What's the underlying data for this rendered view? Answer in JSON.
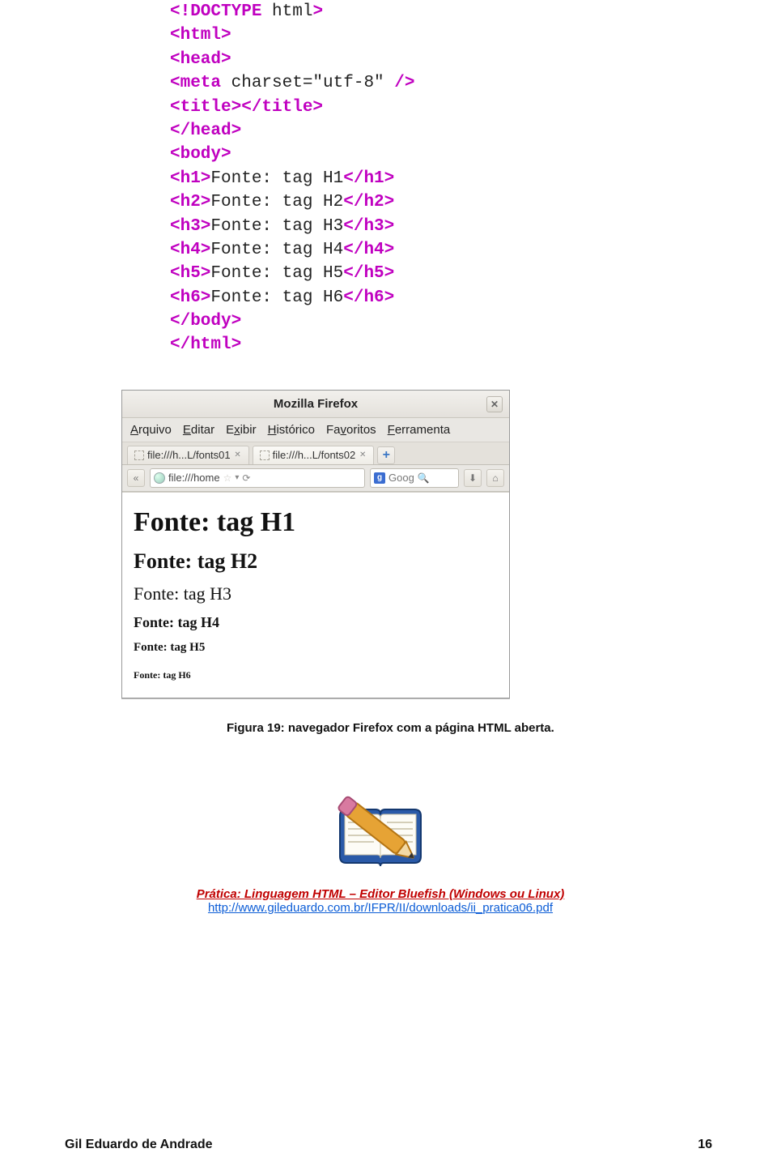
{
  "code": {
    "lines": [
      {
        "pre": "",
        "tag": "<!DOCTYPE",
        "mid": " html",
        "tag2": ">",
        "tail": ""
      },
      {
        "pre": "",
        "tag": "<html>",
        "mid": "",
        "tag2": "",
        "tail": ""
      },
      {
        "pre": "",
        "tag": "<head>",
        "mid": "",
        "tag2": "",
        "tail": ""
      },
      {
        "pre": "",
        "tag": "<meta",
        "mid": " charset=\"utf-8\" ",
        "tag2": "/>",
        "tail": ""
      },
      {
        "pre": "",
        "tag": "<title></title>",
        "mid": "",
        "tag2": "",
        "tail": ""
      },
      {
        "pre": "",
        "tag": "</head>",
        "mid": "",
        "tag2": "",
        "tail": ""
      },
      {
        "pre": "",
        "tag": "<body>",
        "mid": "",
        "tag2": "",
        "tail": ""
      },
      {
        "pre": "",
        "tag": "<h1>",
        "mid": "Fonte: tag H1",
        "tag2": "</h1>",
        "tail": ""
      },
      {
        "pre": "",
        "tag": "<h2>",
        "mid": "Fonte: tag H2",
        "tag2": "</h2>",
        "tail": ""
      },
      {
        "pre": "",
        "tag": "<h3>",
        "mid": "Fonte: tag H3",
        "tag2": "</h3>",
        "tail": ""
      },
      {
        "pre": "",
        "tag": "<h4>",
        "mid": "Fonte: tag H4",
        "tag2": "</h4>",
        "tail": ""
      },
      {
        "pre": "",
        "tag": "<h5>",
        "mid": "Fonte: tag H5",
        "tag2": "</h5>",
        "tail": ""
      },
      {
        "pre": "",
        "tag": "<h6>",
        "mid": "Fonte: tag H6",
        "tag2": "</h6>",
        "tail": ""
      },
      {
        "pre": "",
        "tag": "</body>",
        "mid": "",
        "tag2": "",
        "tail": ""
      },
      {
        "pre": "",
        "tag": "</html>",
        "mid": "",
        "tag2": "",
        "tail": ""
      }
    ]
  },
  "browser": {
    "title": "Mozilla Firefox",
    "menus": [
      "Arquivo",
      "Editar",
      "Exibir",
      "Histórico",
      "Favoritos",
      "Ferramenta"
    ],
    "menu_underlines": [
      "A",
      "E",
      "x",
      "H",
      "v",
      "F"
    ],
    "tabs": [
      {
        "label": "file:///h...L/fonts01",
        "active": false
      },
      {
        "label": "file:///h...L/fonts02",
        "active": true
      }
    ],
    "newtab": "+",
    "urlbar": "file:///home",
    "search_placeholder": "Goog",
    "headings": [
      "Fonte: tag H1",
      "Fonte: tag H2",
      "Fonte: tag H3",
      "Fonte: tag H4",
      "Fonte: tag H5",
      "Fonte: tag H6"
    ]
  },
  "caption": "Figura 19: navegador Firefox com a página HTML aberta.",
  "practice": {
    "title": "Prática: Linguagem HTML – Editor Bluefish (Windows ou Linux)",
    "link": "http://www.gileduardo.com.br/IFPR/II/downloads/ii_pratica06.pdf"
  },
  "footer": {
    "author": "Gil Eduardo de Andrade",
    "page": "16"
  }
}
